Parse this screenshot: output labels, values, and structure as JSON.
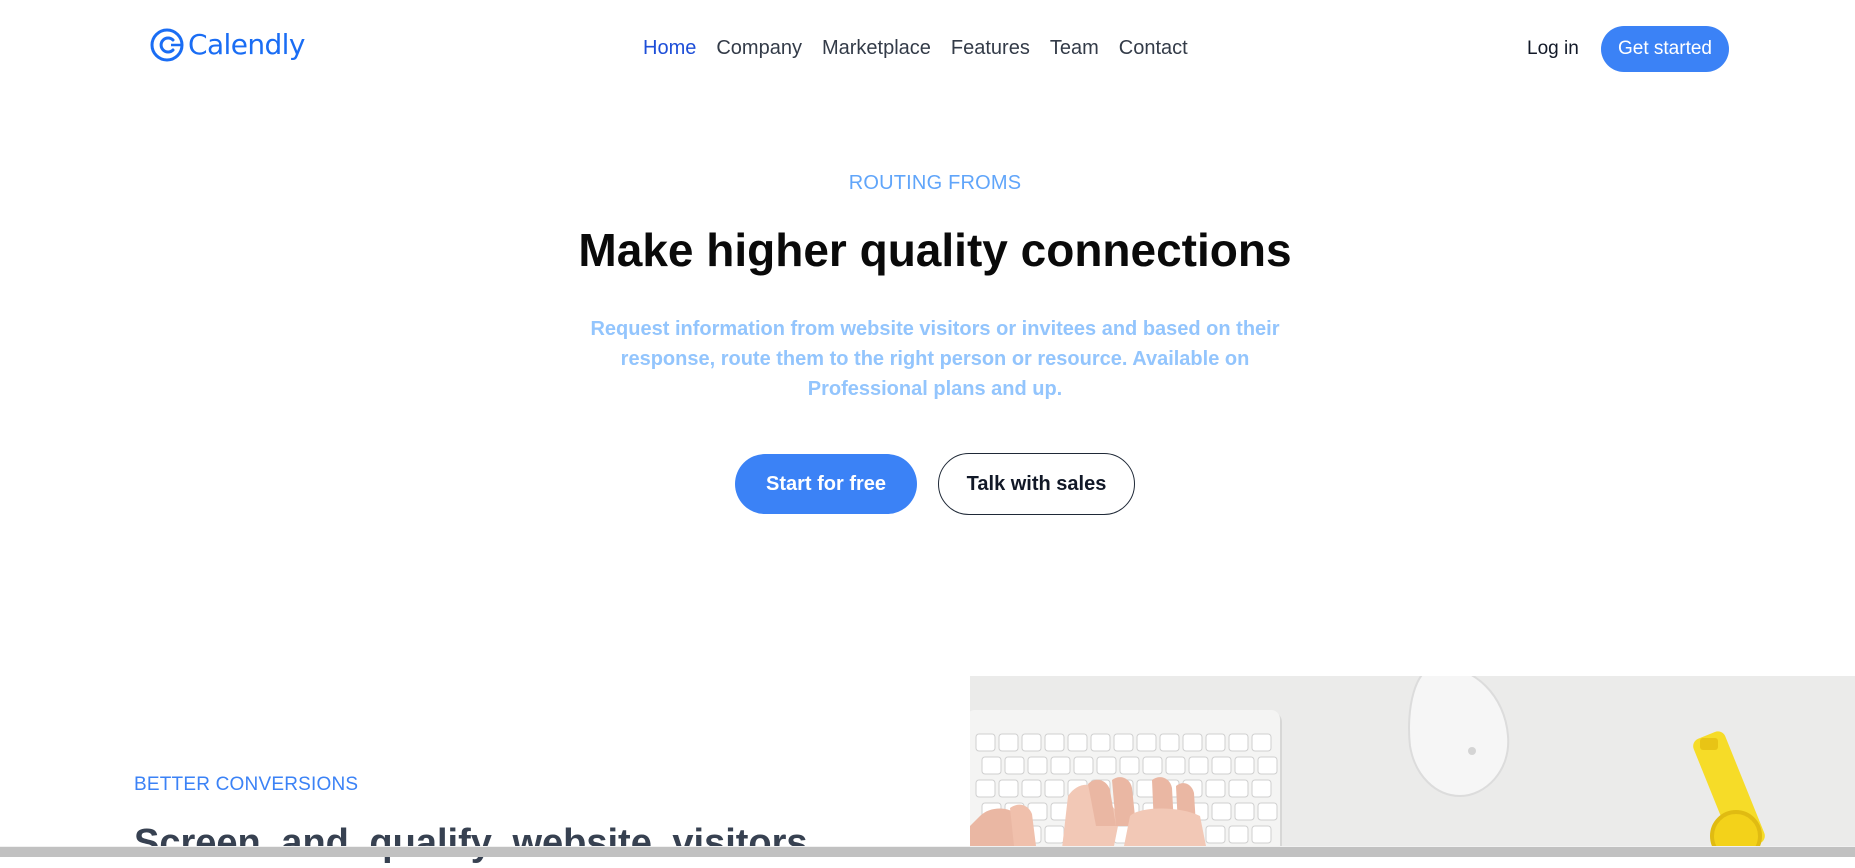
{
  "brand": {
    "name": "Calendly",
    "logo_icon": "calendly-logo-icon",
    "color": "#1a6df4"
  },
  "nav": {
    "items": [
      {
        "label": "Home",
        "active": true
      },
      {
        "label": "Company",
        "active": false
      },
      {
        "label": "Marketplace",
        "active": false
      },
      {
        "label": "Features",
        "active": false
      },
      {
        "label": "Team",
        "active": false
      },
      {
        "label": "Contact",
        "active": false
      }
    ],
    "login_label": "Log in",
    "get_started_label": "Get started"
  },
  "hero": {
    "eyebrow": "ROUTING FROMS",
    "title": "Make higher quality connections",
    "description": "Request information from website visitors or invitees and based on their response, route them to the right person or resource. Available on Professional plans and up.",
    "primary_cta": "Start for free",
    "secondary_cta": "Talk with sales"
  },
  "feature": {
    "eyebrow": "BETTER CONVERSIONS",
    "title": "Screen and qualify website visitors"
  },
  "colors": {
    "accent": "#3b82f6",
    "nav_active": "#1d4ed8",
    "eyebrow": "#60a5fa",
    "description": "#93c5fd"
  }
}
